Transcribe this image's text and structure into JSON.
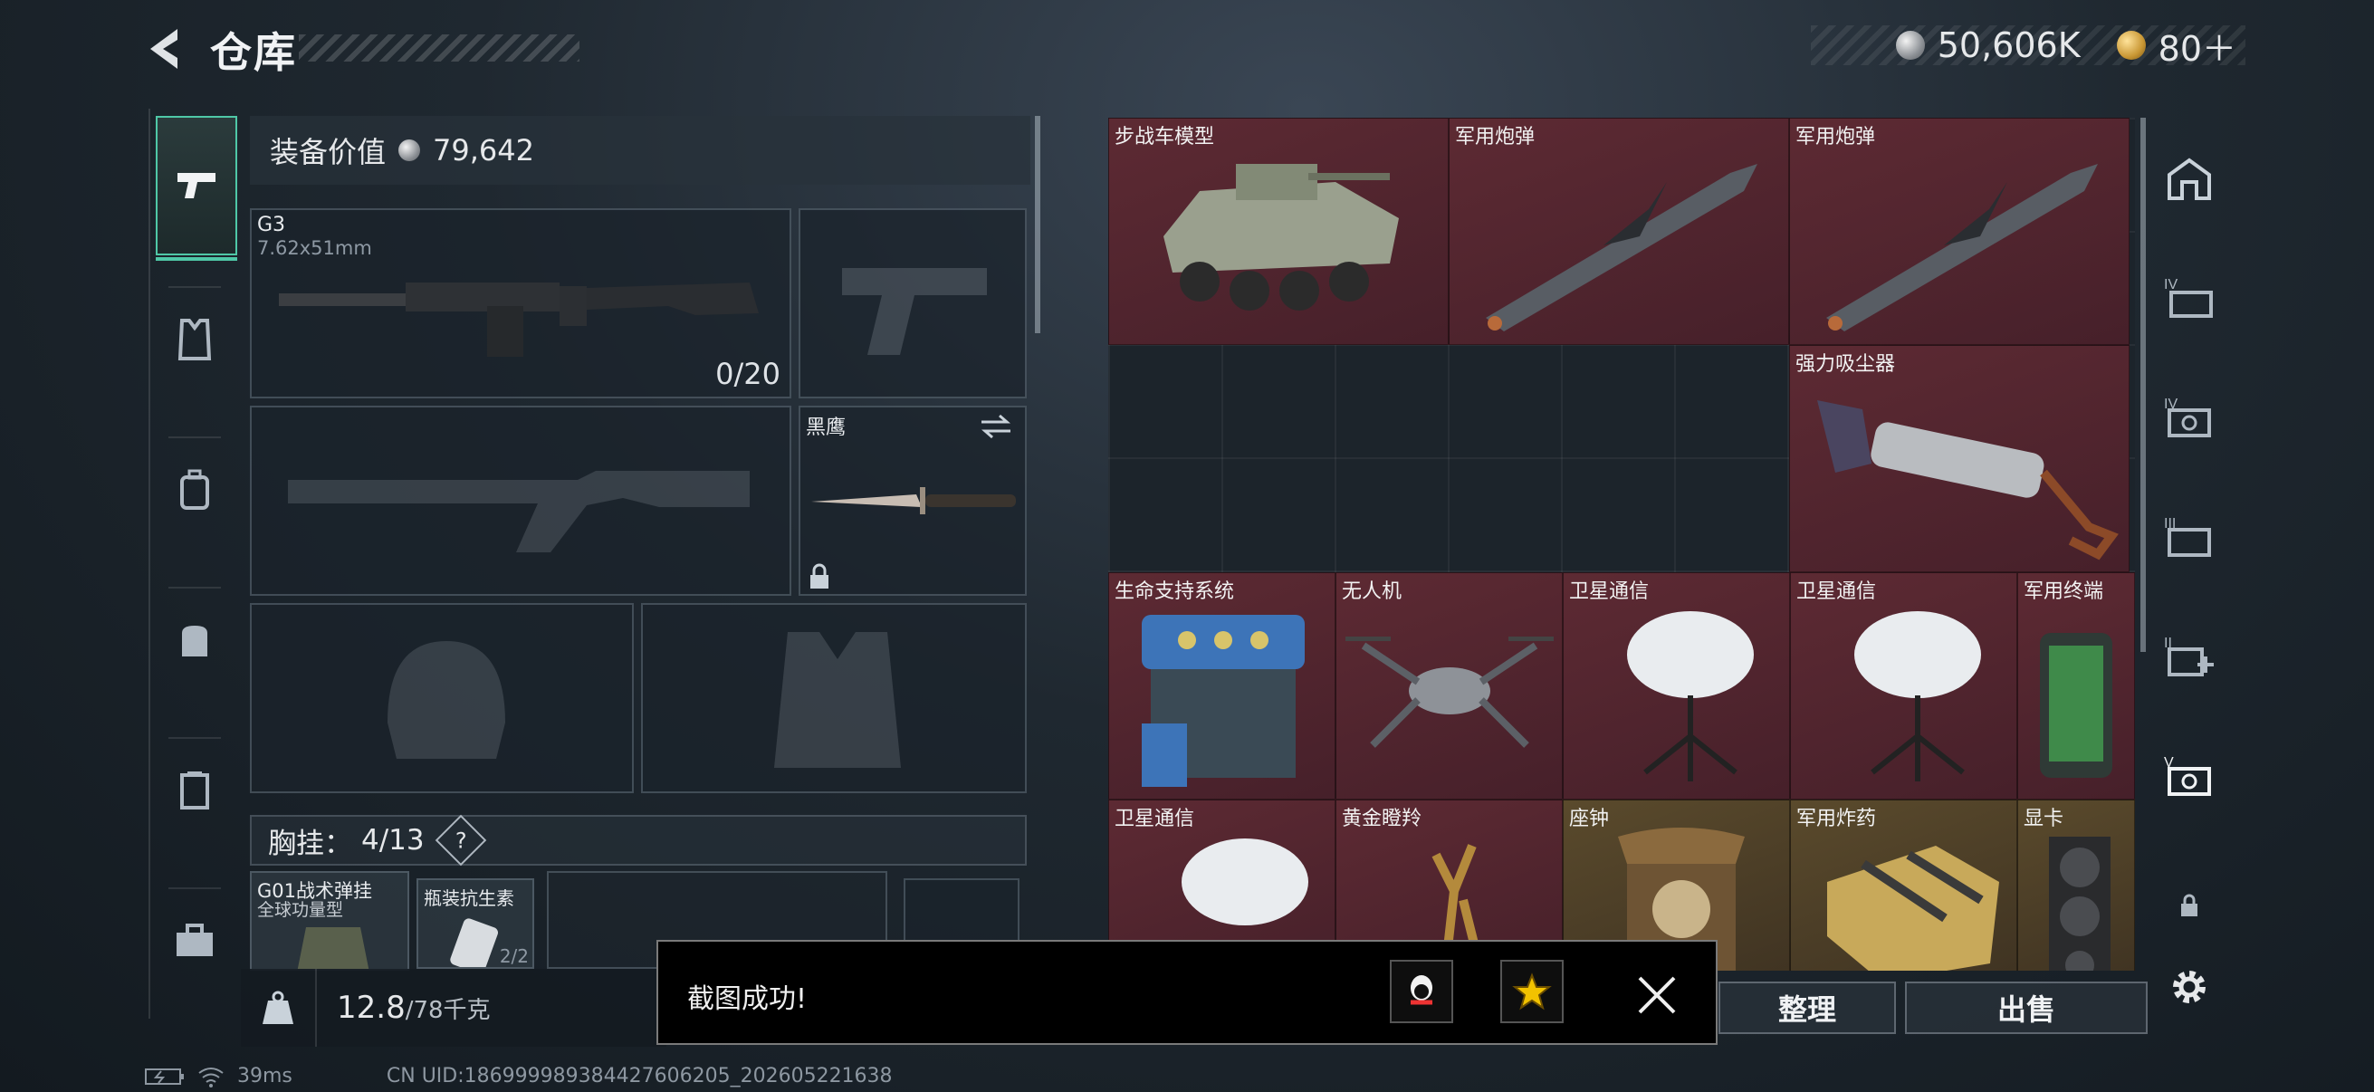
{
  "header": {
    "title": "仓库",
    "currency_main": "50,606K",
    "currency_premium": "80＋"
  },
  "left_tabs": [
    "pistol-icon",
    "vest-icon",
    "backpack-icon",
    "pouch-icon",
    "case-icon",
    "briefcase-icon"
  ],
  "equipment": {
    "value_label": "装备价值",
    "value": "79,642",
    "primary": {
      "name": "G3",
      "caliber": "7.62x51mm",
      "ammo": "0/20"
    },
    "melee": {
      "name": "黑鹰"
    },
    "chest_label": "胸挂：",
    "chest_count": "4/13",
    "chest_help": "?",
    "chest_items": [
      {
        "name": "G01战术弹挂",
        "sub": "全球功量型"
      },
      {
        "name": "瓶装抗生素",
        "count": "2/2"
      }
    ]
  },
  "weight": {
    "current": "12.8",
    "max": "/78千克",
    "icon": "KG"
  },
  "storage": {
    "items": [
      "步战车模型",
      "军用炮弹",
      "军用炮弹",
      "强力吸尘器",
      "生命支持系统",
      "无人机",
      "卫星通信",
      "卫星通信",
      "军用终端",
      "卫星通信",
      "黄金瞪羚",
      "座钟",
      "军用炸药",
      "显卡"
    ]
  },
  "buttons": {
    "sort": "整理",
    "sell": "出售"
  },
  "toast": {
    "message": "截图成功!"
  },
  "status": {
    "ping": "39ms",
    "uid": "CN UID:1869999893844276062​05_202605221638"
  },
  "colors": {
    "accent": "#4fc8a7",
    "red_rarity": "#5d2a33",
    "gold_rarity": "#5a4a2c"
  }
}
